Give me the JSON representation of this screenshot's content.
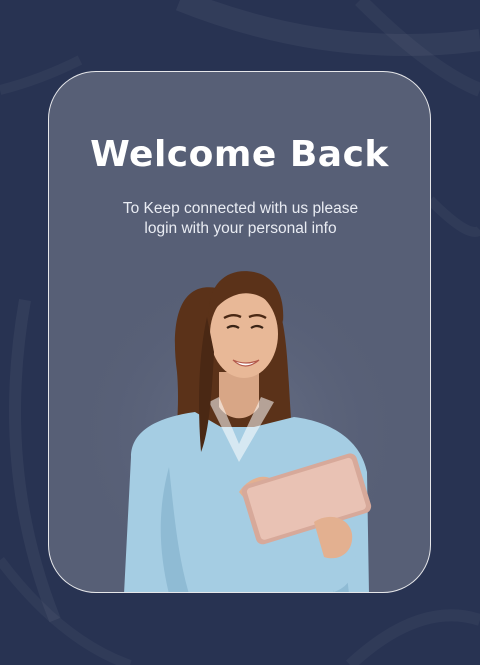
{
  "colors": {
    "background": "#283352",
    "card": "#575f76",
    "card_border": "#ffffff",
    "text": "#ffffff"
  },
  "card": {
    "title": "Welcome Back",
    "subtitle_line1": "To Keep connected with us please",
    "subtitle_line2": "login with your personal info"
  },
  "illustration": {
    "subject": "woman-with-tablet"
  }
}
